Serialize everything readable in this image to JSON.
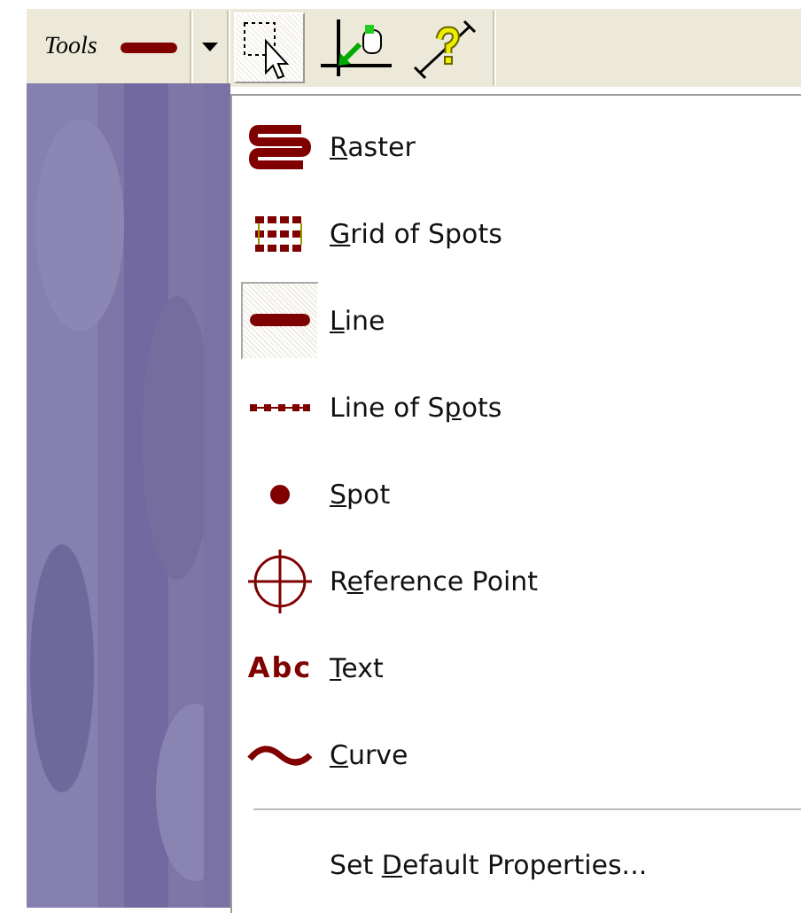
{
  "toolbar": {
    "label": "Tools",
    "buttons": [
      {
        "kind": "current-line",
        "selected": false
      },
      {
        "kind": "dropdown",
        "selected": false
      },
      {
        "kind": "select",
        "selected": true
      },
      {
        "kind": "axis",
        "selected": false
      },
      {
        "kind": "measure",
        "selected": false
      }
    ]
  },
  "menu": {
    "items": [
      {
        "kind": "raster",
        "label": [
          {
            "text": "R",
            "underlined": true
          },
          {
            "text": "aster",
            "underlined": false
          }
        ],
        "selected": false
      },
      {
        "kind": "grid",
        "label": [
          {
            "text": "G",
            "underlined": true
          },
          {
            "text": "rid of Spots",
            "underlined": false
          }
        ],
        "selected": false
      },
      {
        "kind": "line",
        "label": [
          {
            "text": "L",
            "underlined": true
          },
          {
            "text": "ine",
            "underlined": false
          }
        ],
        "selected": true
      },
      {
        "kind": "dots",
        "label": [
          {
            "text": "Line of S",
            "underlined": false
          },
          {
            "text": "p",
            "underlined": true
          },
          {
            "text": "ots",
            "underlined": false
          }
        ],
        "selected": false
      },
      {
        "kind": "spot",
        "label": [
          {
            "text": "S",
            "underlined": true
          },
          {
            "text": "pot",
            "underlined": false
          }
        ],
        "selected": false
      },
      {
        "kind": "crosshair",
        "label": [
          {
            "text": "R",
            "underlined": false
          },
          {
            "text": "e",
            "underlined": true
          },
          {
            "text": "ference Point",
            "underlined": false
          }
        ],
        "selected": false
      },
      {
        "kind": "abc",
        "label": [
          {
            "text": "T",
            "underlined": true
          },
          {
            "text": "ext",
            "underlined": false
          }
        ],
        "icon_text": "Abc",
        "selected": false
      },
      {
        "kind": "curve",
        "label": [
          {
            "text": "C",
            "underlined": true
          },
          {
            "text": "urve",
            "underlined": false
          }
        ],
        "selected": false
      },
      {
        "kind": "separator"
      },
      {
        "kind": "command",
        "label": [
          {
            "text": "Set ",
            "underlined": false
          },
          {
            "text": "D",
            "underlined": true
          },
          {
            "text": "efault Properties...",
            "underlined": false
          }
        ]
      }
    ]
  }
}
